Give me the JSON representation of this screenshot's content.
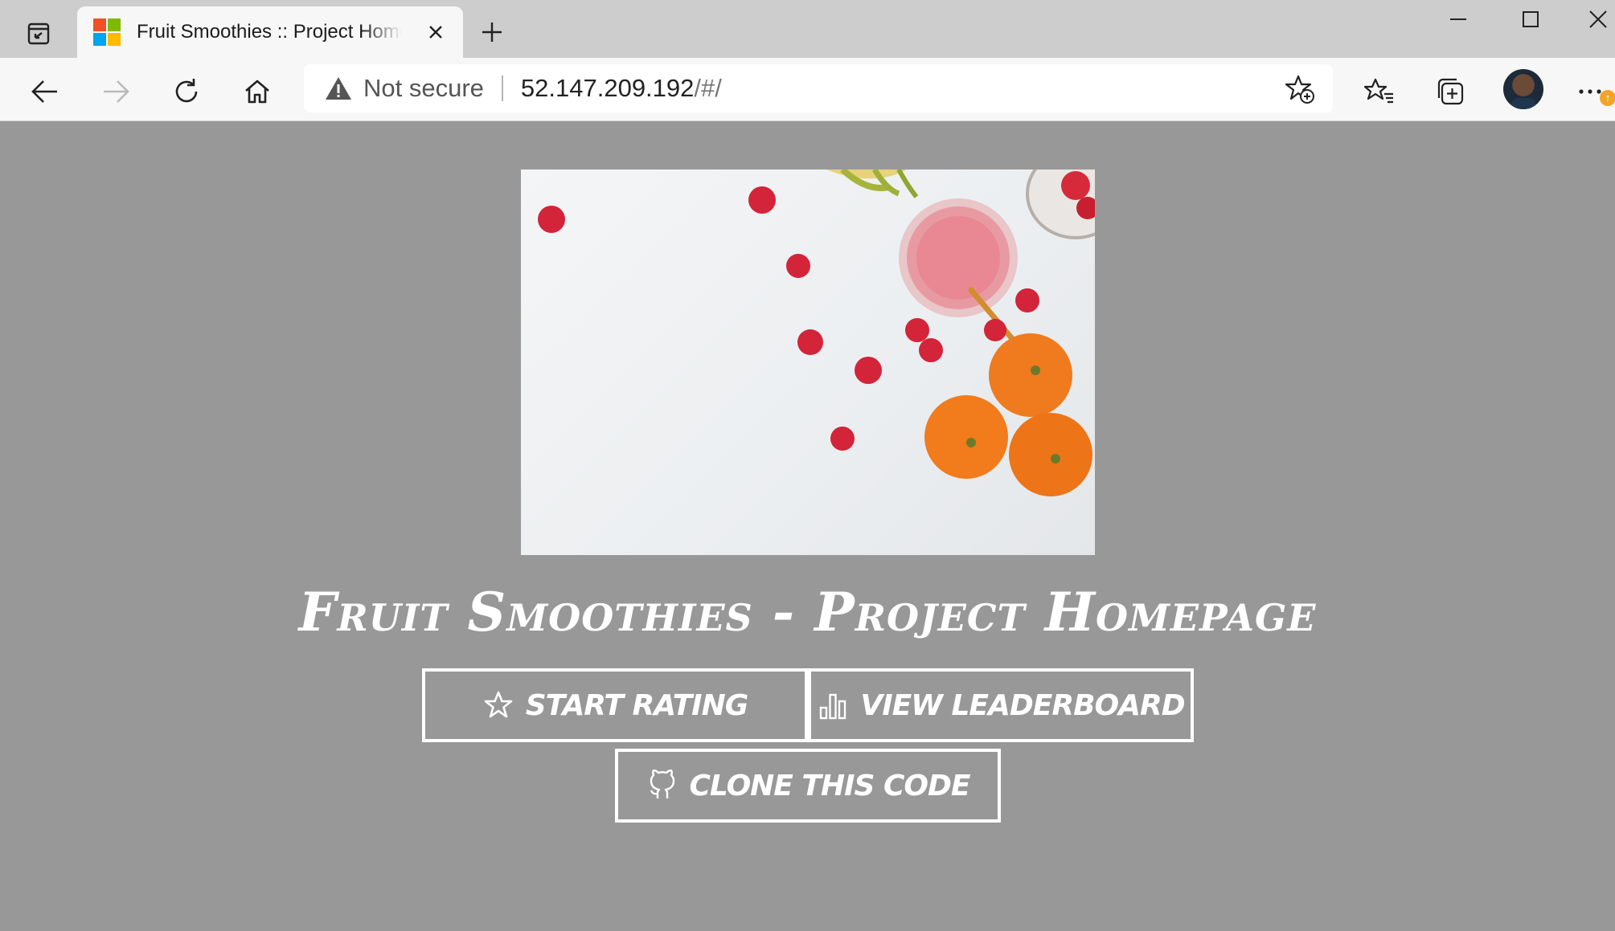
{
  "browser": {
    "tab": {
      "title": "Fruit Smoothies :: Project Homepage"
    },
    "address": {
      "security_label": "Not secure",
      "url_main": "52.147.209.192",
      "url_suffix": "/#/"
    },
    "icons": [
      "tab-actions-icon",
      "microsoft-logo-icon",
      "close-icon",
      "plus-icon",
      "minimize-icon",
      "maximize-icon",
      "close-window-icon",
      "back-arrow-icon",
      "forward-arrow-icon",
      "refresh-icon",
      "home-icon",
      "warning-icon",
      "add-favorite-icon",
      "favorites-icon",
      "collections-icon",
      "more-icon"
    ],
    "colors": {
      "tabstrip": "#cdcdcd",
      "toolbar": "#f7f7f7",
      "update_badge": "#f0a52a"
    }
  },
  "page": {
    "title": "Fruit Smoothies - Project Homepage",
    "buttons": {
      "start_rating": "Start Rating",
      "view_leaderboard": "View Leaderboard",
      "clone_code": "Clone This Code"
    },
    "colors": {
      "background": "#989898",
      "text": "#ffffff"
    }
  }
}
